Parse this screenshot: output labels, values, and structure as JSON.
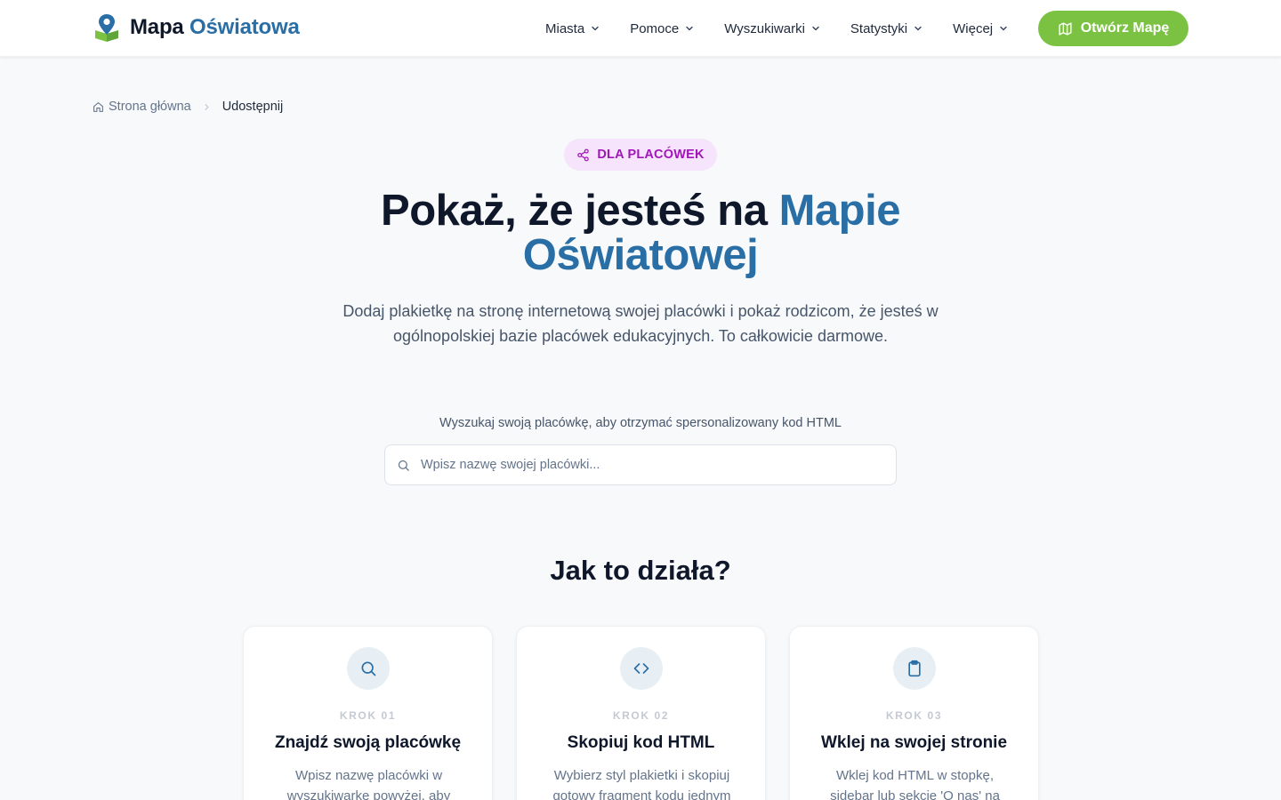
{
  "header": {
    "logo_main": "Mapa",
    "logo_accent": "Oświatowa",
    "nav": [
      "Miasta",
      "Pomoce",
      "Wyszukiwarki",
      "Statystyki",
      "Więcej"
    ],
    "cta_label": "Otwórz Mapę"
  },
  "breadcrumb": {
    "home": "Strona główna",
    "current": "Udostępnij"
  },
  "badge": "DLA PLACÓWEK",
  "hero": {
    "title_start": "Pokaż, że jesteś na",
    "title_accent": "Mapie Oświatowej",
    "subtitle": "Dodaj plakietkę na stronę internetową swojej placówki i pokaż rodzicom, że jesteś w ogólnopolskiej bazie placówek edukacyjnych. To całkowicie darmowe."
  },
  "search": {
    "label": "Wyszukaj swoją placówkę, aby otrzymać spersonalizowany kod HTML",
    "placeholder": "Wpisz nazwę swojej placówki..."
  },
  "how": {
    "title": "Jak to działa?",
    "steps": [
      {
        "step": "KROK 01",
        "title": "Znajdź swoją placówkę",
        "text": "Wpisz nazwę placówki w wyszukiwarkę powyżej, aby",
        "icon": "search-icon"
      },
      {
        "step": "KROK 02",
        "title": "Skopiuj kod HTML",
        "text": "Wybierz styl plakietki i skopiuj gotowy fragment kodu jednym",
        "icon": "code-icon"
      },
      {
        "step": "KROK 03",
        "title": "Wklej na swojej stronie",
        "text": "Wklej kod HTML w stopkę, sidebar lub sekcję 'O nas' na stronie swojej",
        "icon": "clipboard-icon"
      }
    ]
  },
  "colors": {
    "brand_blue": "#2a6ea6",
    "cta_green": "#7cc242",
    "badge_purple": "#a116b8",
    "badge_bg": "#f5e4fb"
  }
}
